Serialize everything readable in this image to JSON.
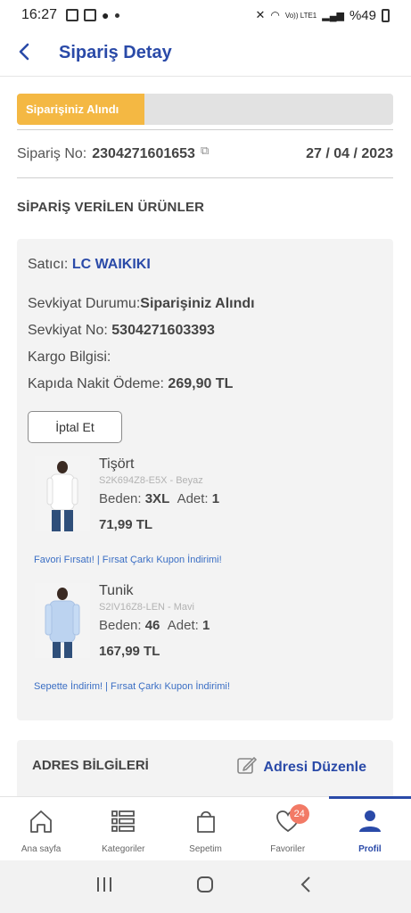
{
  "status_bar": {
    "time": "16:27",
    "battery": "%49",
    "network": "Vo)) LTE1"
  },
  "header": {
    "title": "Sipariş Detay"
  },
  "progress": {
    "label": "Siparişiniz Alındı",
    "fraction": 0.34
  },
  "order": {
    "number_label": "Sipariş No:",
    "number": "2304271601653",
    "date": "27 / 04 / 2023"
  },
  "products_section": {
    "title": "SİPARİŞ VERİLEN ÜRÜNLER"
  },
  "shipment": {
    "seller_label": "Satıcı:",
    "seller": "LC WAIKIKI",
    "status_label": "Sevkiyat Durumu:",
    "status": "Siparişiniz Alındı",
    "shipment_no_label": "Sevkiyat No:",
    "shipment_no": "5304271603393",
    "cargo_label": "Kargo Bilgisi:",
    "payment_label": "Kapıda Nakit Ödeme:",
    "payment_amount": "269,90 TL",
    "cancel_label": "İptal Et"
  },
  "items": [
    {
      "name": "Tişört",
      "sku": "S2K694Z8-E5X - Beyaz",
      "size_label": "Beden:",
      "size": "3XL",
      "qty_label": "Adet:",
      "qty": "1",
      "price": "71,99 TL",
      "promo": "Favori Fırsatı! | Fırsat Çarkı Kupon İndirimi!"
    },
    {
      "name": "Tunik",
      "sku": "S2IV16Z8-LEN - Mavi",
      "size_label": "Beden:",
      "size": "46",
      "qty_label": "Adet:",
      "qty": "1",
      "price": "167,99 TL",
      "promo": "Sepette İndirim! | Fırsat Çarkı Kupon İndirimi!"
    }
  ],
  "address": {
    "title": "ADRES BİLGİLERİ",
    "edit_label": "Adresi Düzenle"
  },
  "tabbar": {
    "items": [
      {
        "label": "Ana sayfa",
        "icon": "home-icon"
      },
      {
        "label": "Kategoriler",
        "icon": "categories-icon"
      },
      {
        "label": "Sepetim",
        "icon": "cart-icon"
      },
      {
        "label": "Favoriler",
        "icon": "heart-icon",
        "badge": "24"
      },
      {
        "label": "Profil",
        "icon": "profile-icon"
      }
    ],
    "active": "Profil"
  },
  "colors": {
    "accent": "#2a4aa8",
    "progress": "#f4b843",
    "badge": "#f27a66",
    "promo": "#3a6ec4"
  }
}
